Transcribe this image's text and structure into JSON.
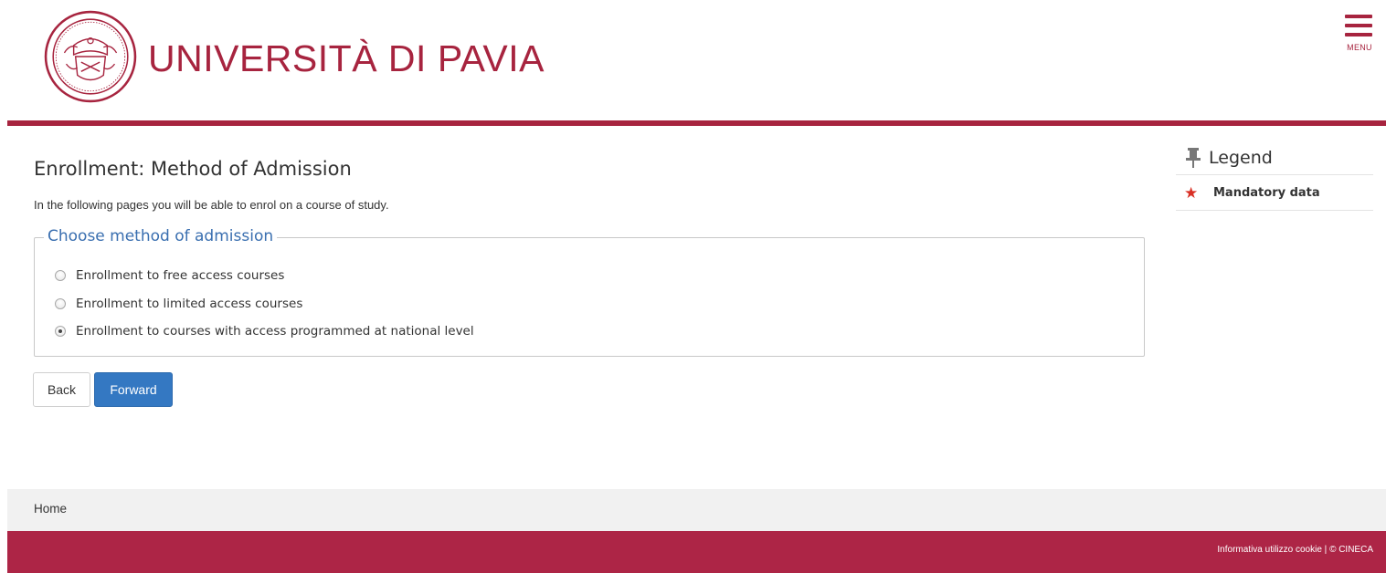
{
  "header": {
    "logo_text": "UNIVERSITÀ DI PAVIA",
    "menu_label": "MENU",
    "brand_color": "#a7243f"
  },
  "main": {
    "title": "Enrollment: Method of Admission",
    "intro": "In the following pages you will be able to enrol on a course of study.",
    "fieldset_legend": "Choose method of admission",
    "options": [
      {
        "label": "Enrollment to free access courses",
        "checked": false
      },
      {
        "label": "Enrollment to limited access courses",
        "checked": false
      },
      {
        "label": "Enrollment to courses with access programmed at national level",
        "checked": true
      }
    ],
    "back_label": "Back",
    "forward_label": "Forward"
  },
  "legend": {
    "title": "Legend",
    "mandatory_symbol": "★",
    "mandatory_label": "Mandatory data"
  },
  "footer": {
    "breadcrumb_home": "Home",
    "cookie_link": "Informativa utilizzo cookie",
    "separator": "|",
    "copyright": "© CINECA",
    "bar_color": "#ad2546"
  },
  "icons": {
    "logo": "university-seal-icon",
    "menu": "hamburger-menu-icon",
    "legend": "pin-icon",
    "mandatory": "star-icon"
  }
}
